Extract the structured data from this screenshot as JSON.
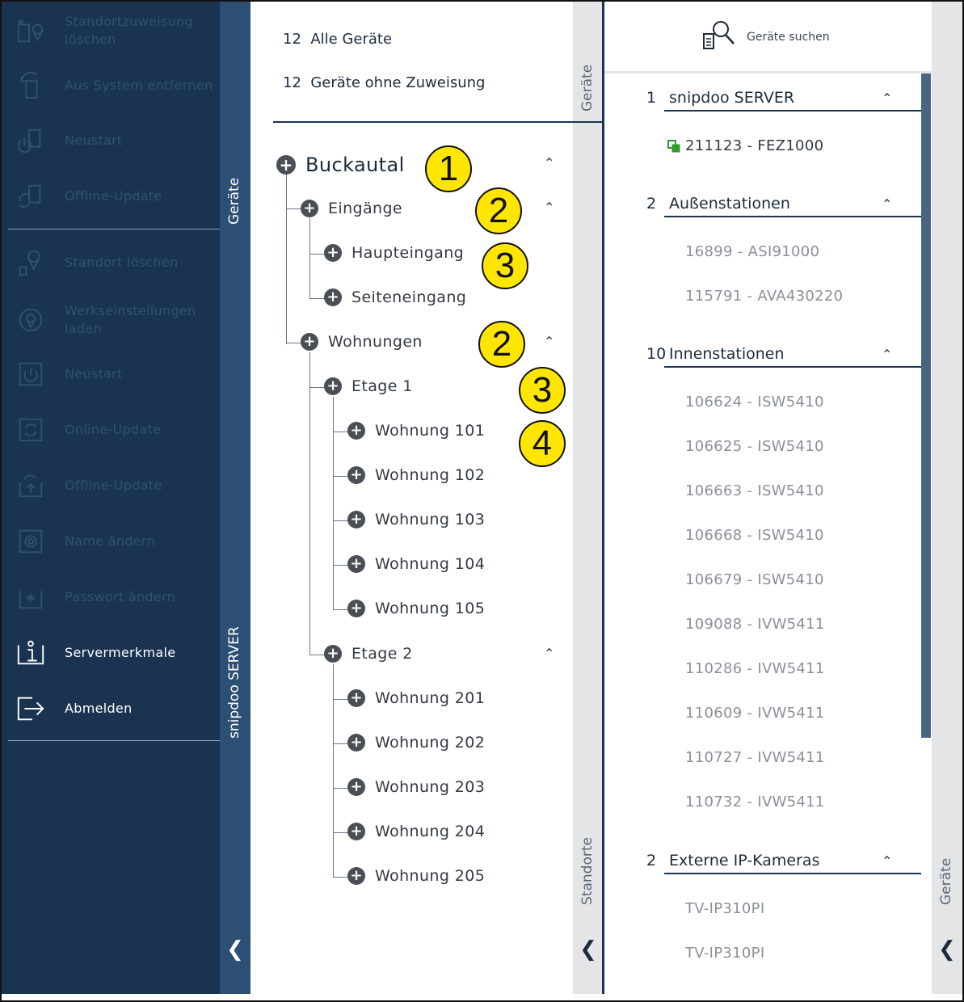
{
  "sidebar": {
    "items": [
      {
        "label": "Standortzuweisung löschen",
        "icon": "unassign-location-icon",
        "active": false
      },
      {
        "label": "Aus System entfernen",
        "icon": "remove-from-system-icon",
        "active": false
      },
      {
        "label": "Neustart",
        "icon": "restart-device-icon",
        "active": false
      },
      {
        "label": "Offline-Update",
        "icon": "offline-update-device-icon",
        "active": false
      },
      {
        "label": "Standort löschen",
        "icon": "delete-location-icon",
        "active": false
      },
      {
        "label": "Werkseinstellungen laden",
        "icon": "factory-reset-icon",
        "active": false
      },
      {
        "label": "Neustart",
        "icon": "power-icon",
        "active": false
      },
      {
        "label": "Online-Update",
        "icon": "online-update-icon",
        "active": false
      },
      {
        "label": "Offline-Update",
        "icon": "offline-update-icon",
        "active": false
      },
      {
        "label": "Name ändern",
        "icon": "gear-icon",
        "active": false
      },
      {
        "label": "Passwort ändern",
        "icon": "password-icon",
        "active": false
      },
      {
        "label": "Servermerkmale",
        "icon": "info-icon",
        "active": true
      },
      {
        "label": "Abmelden",
        "icon": "logout-icon",
        "active": true
      }
    ],
    "tab_top": "Geräte",
    "tab_bottom": "snipdoo SERVER"
  },
  "locations": {
    "all_devices_count": "12",
    "all_devices_label": "Alle Geräte",
    "unassigned_count": "12",
    "unassigned_label": "Geräte ohne Zuweisung",
    "tab_top": "Geräte",
    "tab_bottom": "Standorte",
    "tree": {
      "root": "Buckautal",
      "entrances": "Eingänge",
      "main_entrance": "Haupteingang",
      "side_entrance": "Seiteneingang",
      "apartments": "Wohnungen",
      "floor1": "Etage 1",
      "floor1_units": [
        "Wohnung 101",
        "Wohnung 102",
        "Wohnung 103",
        "Wohnung 104",
        "Wohnung 105"
      ],
      "floor2": "Etage 2",
      "floor2_units": [
        "Wohnung 201",
        "Wohnung 202",
        "Wohnung 203",
        "Wohnung 204",
        "Wohnung 205"
      ]
    },
    "callouts": [
      "1",
      "2",
      "3",
      "2",
      "3",
      "4"
    ]
  },
  "devices": {
    "search_label": "Geräte suchen",
    "tab_label": "Geräte",
    "groups": [
      {
        "count": "1",
        "name": "snipdoo SERVER",
        "items": [
          "211123 - FEZ1000"
        ]
      },
      {
        "count": "2",
        "name": "Außenstationen",
        "items": [
          "16899 - ASI91000",
          "115791 - AVA430220"
        ]
      },
      {
        "count": "10",
        "name": "Innenstationen",
        "items": [
          "106624 - ISW5410",
          "106625 - ISW5410",
          "106663 - ISW5410",
          "106668 - ISW5410",
          "106679 - ISW5410",
          "109088 - IVW5411",
          "110286 - IVW5411",
          "110609 - IVW5411",
          "110727 - IVW5411",
          "110732 - IVW5411"
        ]
      },
      {
        "count": "2",
        "name": "Externe IP-Kameras",
        "items": [
          "TV-IP310PI",
          "TV-IP310PI"
        ]
      }
    ]
  },
  "colors": {
    "sidebar_bg": "#1a3351",
    "sidebar_tab": "#2d4f74",
    "callout": "#ffe600",
    "online": "#2f9b2f"
  }
}
